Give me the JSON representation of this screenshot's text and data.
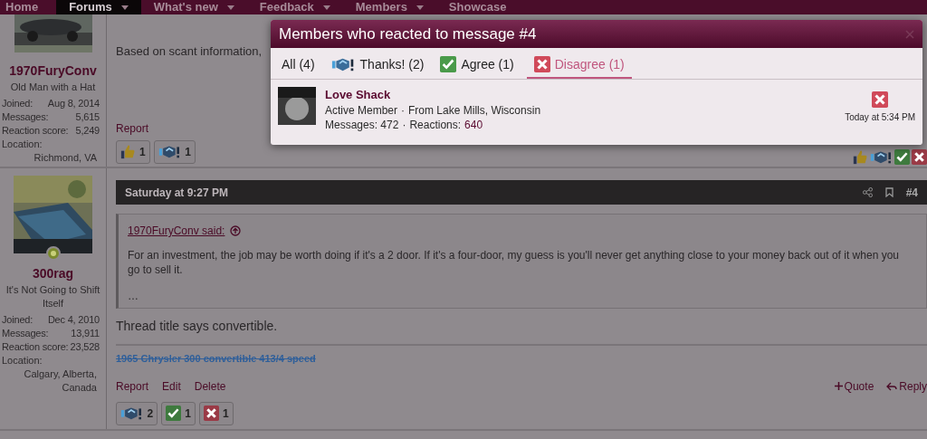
{
  "nav": [
    {
      "label": "Home",
      "selected": false,
      "menu": false
    },
    {
      "label": "Forums",
      "selected": true,
      "menu": true
    },
    {
      "label": "What's new",
      "selected": false,
      "menu": true
    },
    {
      "label": "Feedback",
      "selected": false,
      "menu": true
    },
    {
      "label": "Members",
      "selected": false,
      "menu": true
    },
    {
      "label": "Showcase",
      "selected": false,
      "menu": false
    }
  ],
  "posts": [
    {
      "author": {
        "name": "1970FuryConv",
        "title": "Old Man with a Hat",
        "stats": [
          {
            "label": "Joined:",
            "value": "Aug 8, 2014"
          },
          {
            "label": "Messages:",
            "value": "5,615"
          },
          {
            "label": "Reaction score:",
            "value": "5,249"
          }
        ],
        "location_label": "Location:",
        "location": "Richmond, VA"
      },
      "body": "Based on scant information,",
      "actions": [
        "Report"
      ],
      "reactions": [
        {
          "kind": "like",
          "count": "1"
        },
        {
          "kind": "thanks",
          "count": "1"
        }
      ],
      "summary": [
        {
          "kind": "like"
        },
        {
          "kind": "thanks"
        },
        {
          "kind": "agree"
        },
        {
          "kind": "disagree"
        }
      ]
    },
    {
      "author": {
        "name": "300rag",
        "title": "It's Not Going to Shift Itself",
        "online": true,
        "stats": [
          {
            "label": "Joined:",
            "value": "Dec 4, 2010"
          },
          {
            "label": "Messages:",
            "value": "13,911"
          },
          {
            "label": "Reaction score:",
            "value": "23,528"
          }
        ],
        "location_label": "Location:",
        "location": "Calgary, Alberta, Canada"
      },
      "date": "Saturday at 9:27 PM",
      "number": "#4",
      "quote": {
        "source": "1970FuryConv said:",
        "text": "For an investment, the job may be worth doing if it's a 2 door. If it's a four-door, my guess is you'll never get anything close to your money back out of it when you go to sell it.",
        "more": "…"
      },
      "body": "Thread title says convertible.",
      "signature": "1965 Chrysler 300 convertible 413/4 speed",
      "actions": [
        "Report",
        "Edit",
        "Delete"
      ],
      "right_actions": [
        {
          "kind": "quote",
          "label": "Quote"
        },
        {
          "kind": "reply",
          "label": "Reply"
        }
      ],
      "reactions": [
        {
          "kind": "thanks",
          "count": "2"
        },
        {
          "kind": "agree",
          "count": "1"
        },
        {
          "kind": "disagree",
          "count": "1"
        }
      ]
    }
  ],
  "modal": {
    "title": "Members who reacted to message #4",
    "tabs": [
      {
        "label": "All (4)",
        "kind": "all",
        "selected": false
      },
      {
        "label": "Thanks! (2)",
        "kind": "thanks",
        "selected": false
      },
      {
        "label": "Agree (1)",
        "kind": "agree",
        "selected": false
      },
      {
        "label": "Disagree (1)",
        "kind": "disagree",
        "selected": true
      }
    ],
    "members": [
      {
        "name": "Love Shack",
        "role": "Active Member",
        "from": "From Lake Mills, Wisconsin",
        "messages": "Messages: 472",
        "separator_1": "·",
        "separator_2": "·",
        "reactions_label": "Reactions:",
        "reactions": "640",
        "kind": "disagree",
        "time": "Today at 5:34 PM"
      }
    ]
  }
}
